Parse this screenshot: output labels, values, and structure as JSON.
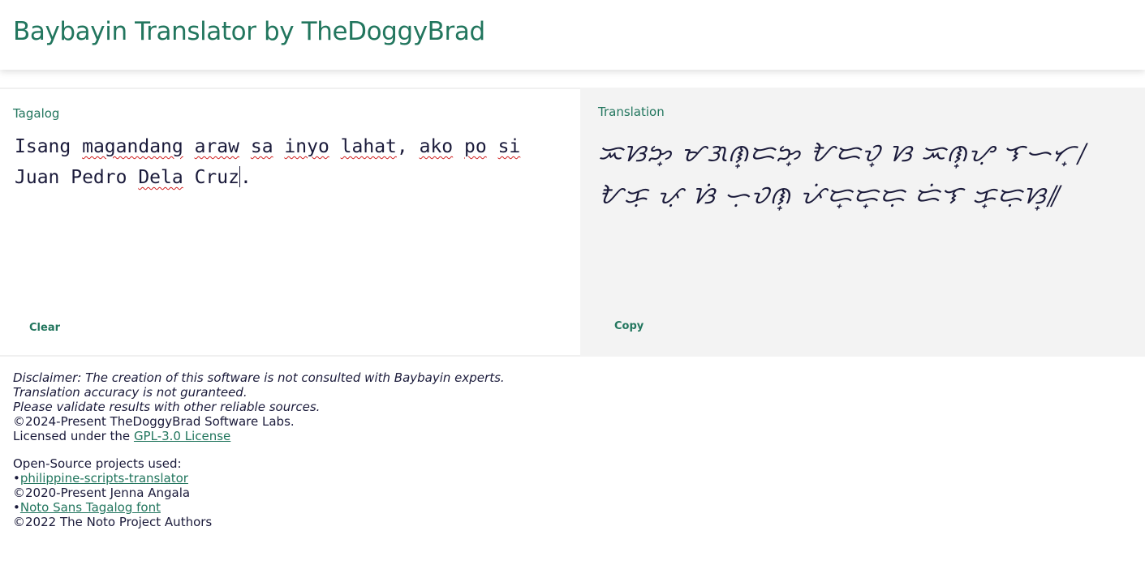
{
  "header": {
    "title": "Baybayin Translator by TheDoggyBrad"
  },
  "source": {
    "label": "Tagalog",
    "text_parts": [
      {
        "text": "Isang",
        "spell": false
      },
      {
        "text": " ",
        "spell": false
      },
      {
        "text": "magandang",
        "spell": true
      },
      {
        "text": " ",
        "spell": false
      },
      {
        "text": "araw",
        "spell": true
      },
      {
        "text": " ",
        "spell": false
      },
      {
        "text": "sa",
        "spell": true
      },
      {
        "text": " ",
        "spell": false
      },
      {
        "text": "inyo",
        "spell": true
      },
      {
        "text": " ",
        "spell": false
      },
      {
        "text": "lahat",
        "spell": true
      },
      {
        "text": ", ",
        "spell": false
      },
      {
        "text": "ako",
        "spell": true
      },
      {
        "text": " ",
        "spell": false
      },
      {
        "text": "po",
        "spell": true
      },
      {
        "text": " ",
        "spell": false
      },
      {
        "text": "si",
        "spell": true
      },
      {
        "text": " Juan Pedro ",
        "spell": false
      },
      {
        "text": "Dela",
        "spell": true
      },
      {
        "text": " Cruz",
        "spell": false
      },
      {
        "text": "|",
        "spell": false
      },
      {
        "text": ".",
        "spell": false
      }
    ],
    "clear_label": "Clear"
  },
  "target": {
    "label": "Translation",
    "text": "ᜁᜐᜅ᜔ ᜋᜄᜈ᜔ᜇᜅ᜔ ᜀᜇᜏ᜔ ᜐ ᜁᜈ᜔ᜌᜓ ᜎᜑᜆ᜔᜵ ᜀᜃᜓ ᜉᜓ ᜐᜒ ᜑᜓᜏᜈ᜔ ᜉᜒᜇ᜔ᜇ᜔ᜇᜓ ᜇᜒᜎ ᜃ᜔ᜇᜓᜐ᜔᜶",
    "copy_label": "Copy"
  },
  "footer": {
    "disclaimer_1": "Disclaimer: The creation of this software is not consulted with Baybayin experts.",
    "disclaimer_2": "Translation accuracy is not guranteed.",
    "disclaimer_3": "Please validate results with other reliable sources.",
    "copyright": "©2024-Present TheDoggyBrad Software Labs.",
    "license_prefix": "Licensed under the ",
    "license_link": "GPL-3.0 License",
    "projects_heading": "Open-Source projects used:",
    "bullet": "•",
    "project_1_link": "philippine-scripts-translator",
    "project_1_credit": "©2020-Present Jenna Angala",
    "project_2_link": "Noto Sans Tagalog font",
    "project_2_credit": "©2022 The Noto Project Authors"
  }
}
